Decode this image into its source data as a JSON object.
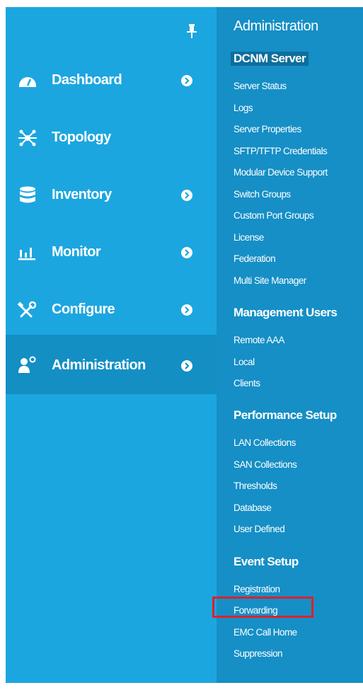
{
  "nav": {
    "items": [
      {
        "label": "Dashboard",
        "icon": "dashboard-icon",
        "has_submenu": true,
        "active": false
      },
      {
        "label": "Topology",
        "icon": "topology-icon",
        "has_submenu": false,
        "active": false
      },
      {
        "label": "Inventory",
        "icon": "database-icon",
        "has_submenu": true,
        "active": false
      },
      {
        "label": "Monitor",
        "icon": "bar-chart-icon",
        "has_submenu": true,
        "active": false
      },
      {
        "label": "Configure",
        "icon": "tools-icon",
        "has_submenu": true,
        "active": false
      },
      {
        "label": "Administration",
        "icon": "admin-user-icon",
        "has_submenu": true,
        "active": true
      }
    ]
  },
  "submenu": {
    "title": "Administration",
    "sections": [
      {
        "heading": "DCNM Server",
        "items": [
          "Server Status",
          "Logs",
          "Server Properties",
          "SFTP/TFTP Credentials",
          "Modular Device Support",
          "Switch Groups",
          "Custom Port Groups",
          "License",
          "Federation",
          "Multi Site Manager"
        ]
      },
      {
        "heading": "Management Users",
        "items": [
          "Remote AAA",
          "Local",
          "Clients"
        ]
      },
      {
        "heading": "Performance Setup",
        "items": [
          "LAN Collections",
          "SAN Collections",
          "Thresholds",
          "Database",
          "User Defined"
        ]
      },
      {
        "heading": "Event Setup",
        "items": [
          "Registration",
          "Forwarding",
          "EMC Call Home",
          "Suppression"
        ]
      }
    ],
    "highlighted_item": "Forwarding"
  },
  "colors": {
    "nav_bg": "#1ca6df",
    "submenu_bg": "#158fc6",
    "active_bg": "#138fc4",
    "highlight": "#e0202a"
  }
}
